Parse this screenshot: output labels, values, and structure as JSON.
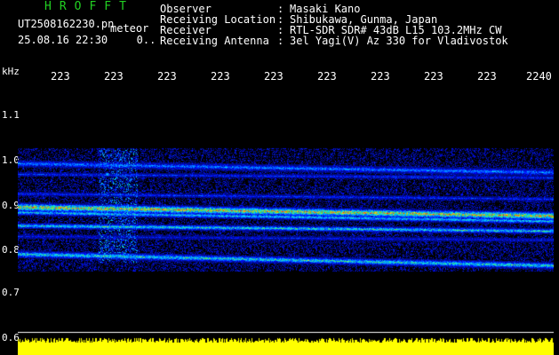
{
  "header": {
    "app_title": "HROFFT",
    "file_name": "UT2508162230.pn",
    "meteor_label": "meteor",
    "date_time": "25.08.16 22:30",
    "count": "0.."
  },
  "info": [
    {
      "label": "Observer",
      "value": "Masaki Kano"
    },
    {
      "label": "Receiving Location",
      "value": "Shibukawa, Gunma, Japan"
    },
    {
      "label": "Receiver",
      "value": "RTL-SDR SDR# 43dB L15 103.2MHz CW"
    },
    {
      "label": "Receiving Antenna",
      "value": "3el Yagi(V) Az 330 for Vladivostok"
    }
  ],
  "axes": {
    "unit": "kHz",
    "x_ticks": [
      "223",
      "223",
      "223",
      "223",
      "223",
      "223",
      "223",
      "223",
      "223",
      "2240"
    ],
    "y_ticks": [
      "1.1",
      "1.0",
      "0.9",
      "0.8",
      "0.7",
      "0.6"
    ]
  },
  "colors": {
    "background": "#000000",
    "title_green": "#22d022",
    "text": "#ffffff",
    "power_yellow": "#ffff00",
    "noise_blue": "#0a1a9a"
  }
}
